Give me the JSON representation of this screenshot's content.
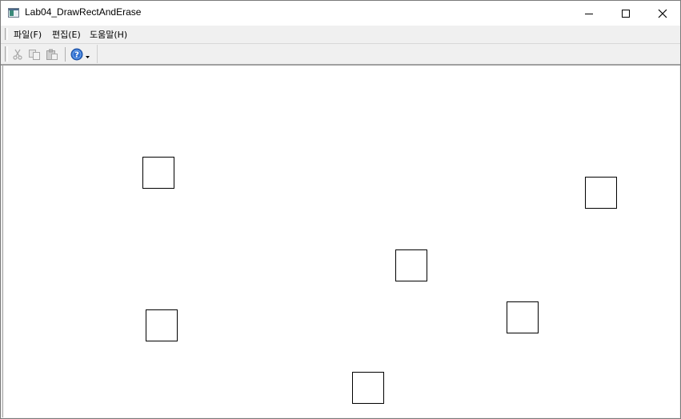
{
  "window": {
    "title": "Lab04_DrawRectAndErase",
    "controls": {
      "minimize_icon": "minimize-icon",
      "maximize_icon": "maximize-icon",
      "close_icon": "close-icon"
    }
  },
  "menu": {
    "items": [
      {
        "label": "파일(F)"
      },
      {
        "label": "편집(E)"
      },
      {
        "label": "도움말(H)"
      }
    ]
  },
  "toolbar": {
    "tools": [
      {
        "icon": "cut-icon",
        "enabled": false
      },
      {
        "icon": "copy-icon",
        "enabled": false
      },
      {
        "icon": "paste-icon",
        "enabled": false
      },
      {
        "icon": "help-icon",
        "enabled": true
      }
    ]
  },
  "canvas": {
    "background": "#ffffff",
    "shape_count": 6,
    "stroke_color": "#000000"
  }
}
